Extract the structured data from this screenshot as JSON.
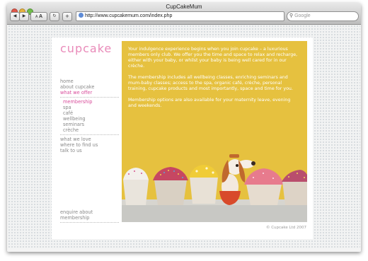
{
  "window": {
    "title": "CupCakeMum",
    "traffic_light_colors": [
      "#e0584a",
      "#e7b33d",
      "#6fbe49"
    ]
  },
  "toolbar": {
    "back_icon": "back-arrow-icon",
    "forward_icon": "forward-arrow-icon",
    "text_small": "A",
    "text_large": "A",
    "reload_icon": "reload-icon",
    "add_bookmark": "+",
    "url": "http://www.cupcakemum.com/index.php",
    "search_placeholder": "Google"
  },
  "site": {
    "brand": "cupcake",
    "nav_main": [
      {
        "label": "home"
      },
      {
        "label": "about cupcake"
      },
      {
        "label": "what we offer",
        "active": true
      }
    ],
    "nav_sub": [
      {
        "label": "membership",
        "current": true
      },
      {
        "label": "spa"
      },
      {
        "label": "café"
      },
      {
        "label": "wellbeing"
      },
      {
        "label": "seminars"
      },
      {
        "label": "crèche"
      }
    ],
    "nav_secondary": [
      {
        "label": "what we love"
      },
      {
        "label": "where to find us"
      },
      {
        "label": "talk to us"
      }
    ],
    "enquire": {
      "line1": "enquire about",
      "line2": "membership"
    },
    "hero": {
      "paragraphs": [
        "Your indulgence experience begins when you join cupcake – a luxurious members only club. We offer you the time and space to relax and recharge, either with your baby, or whilst your baby is being well cared for in our crèche.",
        "The membership includes all wellbeing classes, enriching seminars and mum-baby classes; access to the spa, organic café, crèche, personal training, cupcake products and most importantly, space and time for you.",
        "Membership options are also available for your maternity leave, evening and weekends."
      ],
      "image": "cupcakes-with-knitted-dog-toy"
    },
    "footer": "© Cupcake Ltd 2007"
  },
  "colors": {
    "brand_pink": "#e98ab9",
    "active_pink": "#d84b9a",
    "hero_yellow": "#e6c13f",
    "nav_grey": "#888888"
  }
}
